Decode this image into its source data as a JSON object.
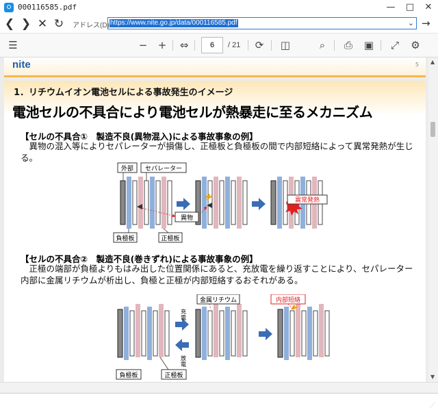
{
  "window": {
    "title": "000116585.pdf",
    "controls": {
      "minimize": "—",
      "maximize": "□",
      "close": "✕"
    }
  },
  "addressbar": {
    "label": "アドレス(D)",
    "url": "https://www.nite.go.jp/data/000116585.pdf"
  },
  "toolbar": {
    "current_page": "6",
    "total_pages": "/ 21"
  },
  "document": {
    "prev_page": {
      "logo": "nite",
      "page_number": "5"
    },
    "heading": "1．リチウムイオン電池セルによる事故発生のイメージ",
    "title": "電池セルの不具合により電池セルが熱暴走に至るメカニズム",
    "section1": {
      "heading": "【セルの不具合①　製造不良(異物混入)による事故事象の例】",
      "body": "　異物の混入等によりセパレーターが損傷し、正極板と負極板の間で内部短絡によって異常発熱が生じる。",
      "labels": {
        "outer": "外部",
        "separator": "セパレーター",
        "foreign": "異物",
        "anode": "負極板",
        "cathode": "正極板",
        "abnormal_heat": "異常発熱"
      }
    },
    "section2": {
      "heading": "【セルの不具合②　製造不良(巻きずれ)による事故事象の例】",
      "body": "　正極の端部が負極よりもはみ出した位置関係にあると、充放電を繰り返すことにより、セパレーター内部に金属リチウムが析出し、負極と正極が内部短絡するおそれがある。",
      "labels": {
        "lithium": "金属リチウム",
        "short": "内部短絡",
        "charge1": "充",
        "charge2": "電",
        "discharge1": "放",
        "discharge2": "電",
        "anode": "負極板",
        "cathode": "正極板"
      }
    }
  },
  "colors": {
    "blue_plate": "#8fb0dc",
    "pink_plate": "#e2b6bd",
    "arrow": "#3a6db5",
    "accent": "#f6b84a",
    "red": "#e01f1f"
  }
}
